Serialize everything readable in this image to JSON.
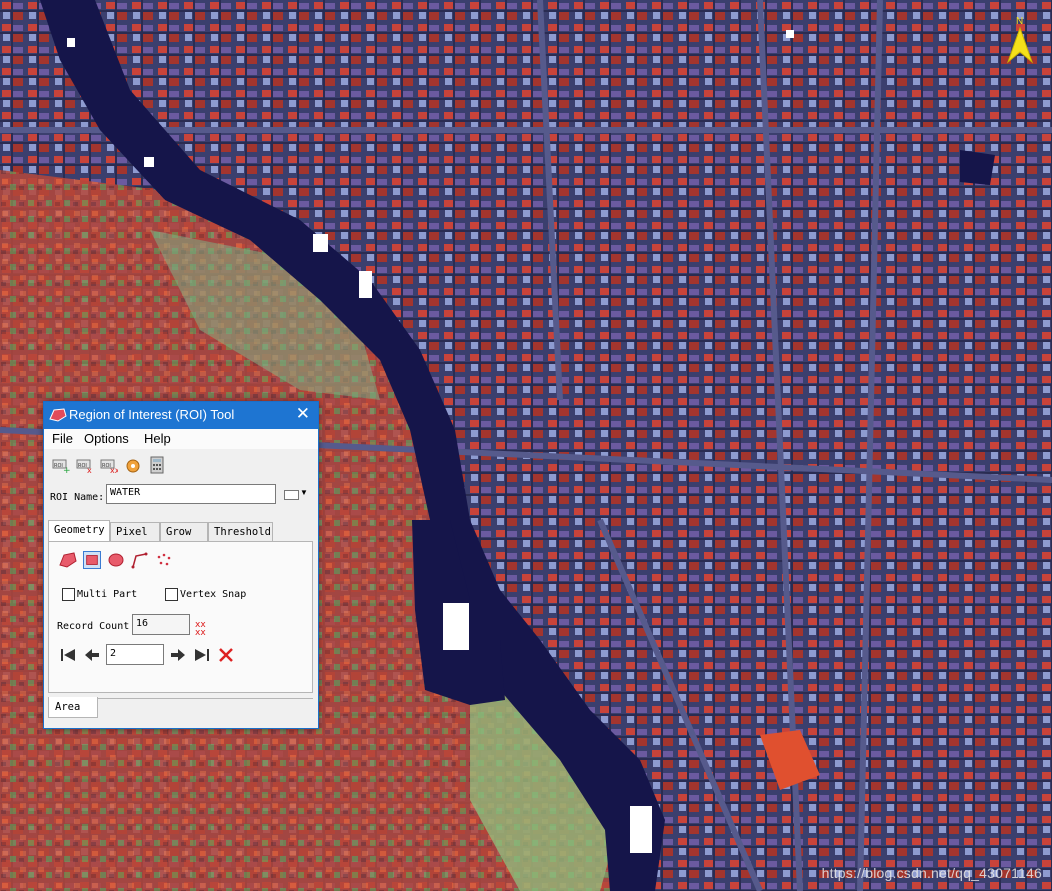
{
  "image": {
    "type": "false-color satellite image",
    "north_label": "N"
  },
  "watermark": "https://blog.csdn.net/qq_43071146",
  "dialog": {
    "title": "Region of Interest (ROI) Tool",
    "menu": [
      "File",
      "Options",
      "Help"
    ],
    "toolbar_icons": [
      "new-roi-icon",
      "delete-roi-icon",
      "delete-all-roi-icon",
      "go-to-roi-icon",
      "calculator-icon"
    ],
    "roi_name_label": "ROI Name:",
    "roi_name_value": "WATER",
    "tabs": [
      "Geometry",
      "Pixel",
      "Grow",
      "Threshold"
    ],
    "active_tab": "Geometry",
    "geometry_icons": [
      "polygon-icon",
      "rectangle-icon",
      "ellipse-icon",
      "polyline-icon",
      "point-icon"
    ],
    "multi_part_label": "Multi Part",
    "vertex_snap_label": "Vertex Snap",
    "record_count_label": "Record Count",
    "record_count_value": "16",
    "record_number_value": "2",
    "bottom_tab": "Area"
  }
}
